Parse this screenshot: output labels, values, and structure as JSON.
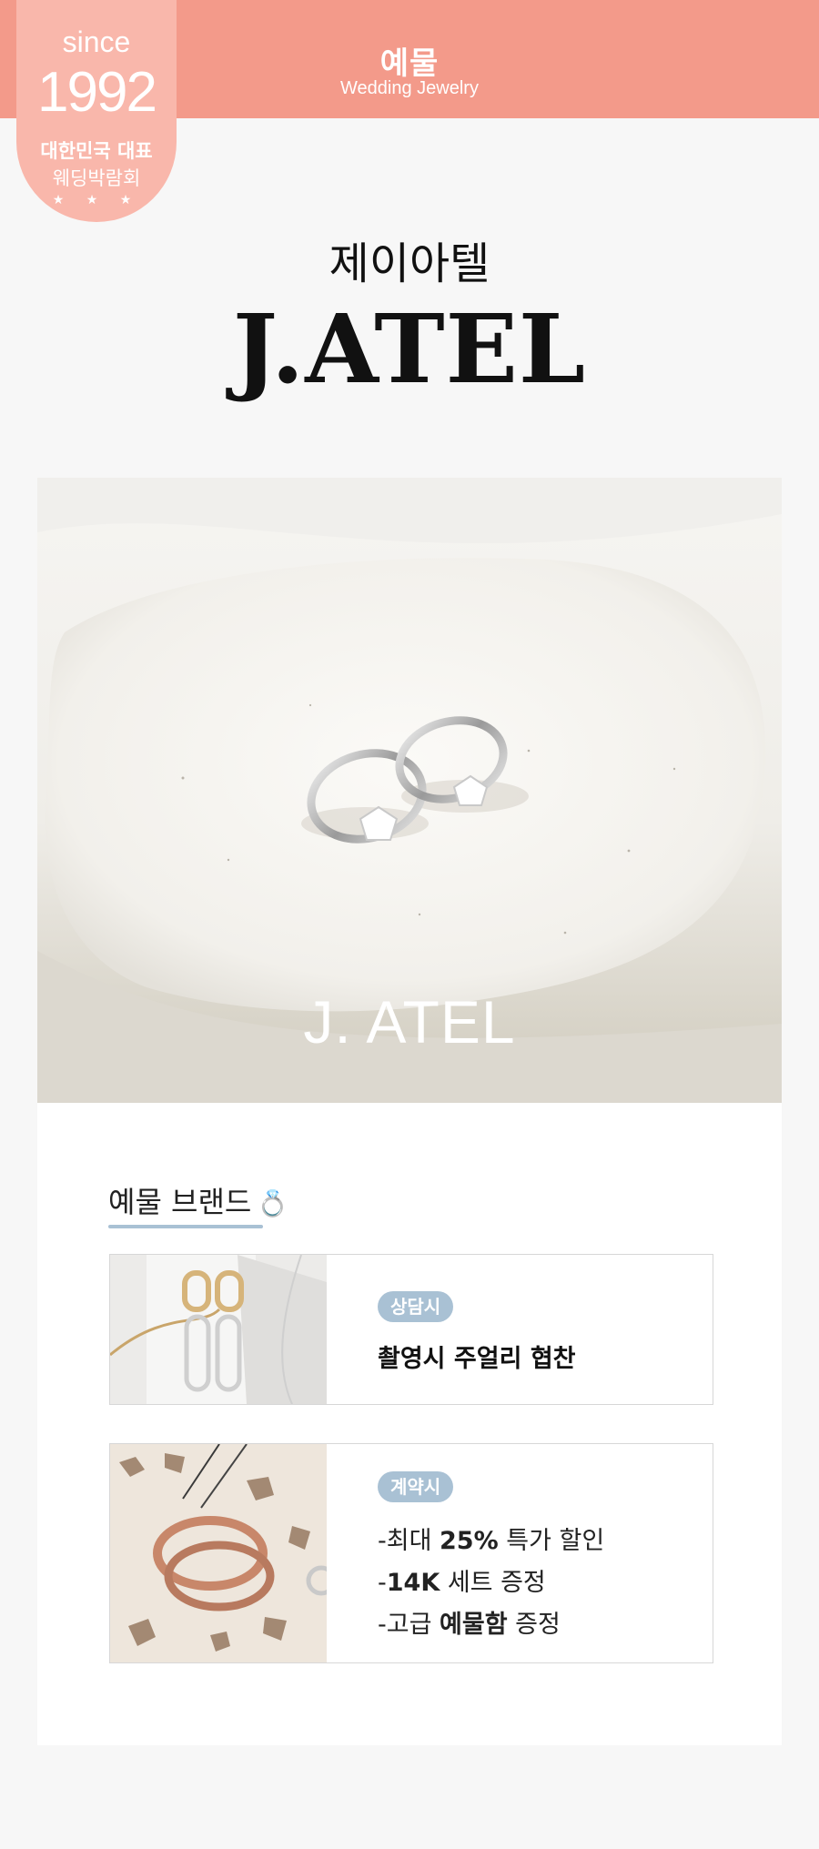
{
  "header": {
    "title_ko": "예물",
    "title_en": "Wedding Jewelry"
  },
  "badge": {
    "since": "since",
    "year": "1992",
    "line1": "대한민국 대표",
    "line2": "웨딩박람회",
    "stars": "★ ★ ★"
  },
  "brand": {
    "name_ko": "제이아텔",
    "name_en": "J.ATEL"
  },
  "hero": {
    "logo_text": "J. ATEL"
  },
  "section": {
    "title": "예물 브랜드",
    "icon": "ring-icon"
  },
  "benefits": [
    {
      "tag": "상담시",
      "text": "촬영시 주얼리 협찬"
    },
    {
      "tag": "계약시",
      "lines": [
        {
          "prefix": "-최대 ",
          "bold": "25%",
          "suffix": " 특가 할인"
        },
        {
          "prefix": "-",
          "bold": "14K",
          "suffix": " 세트 증정"
        },
        {
          "prefix": "-고급 ",
          "bold": "예물함",
          "suffix": " 증정"
        }
      ]
    }
  ],
  "colors": {
    "header": "#f39a8a",
    "badge": "#f9b7ab",
    "accent": "#a9c1d4"
  }
}
